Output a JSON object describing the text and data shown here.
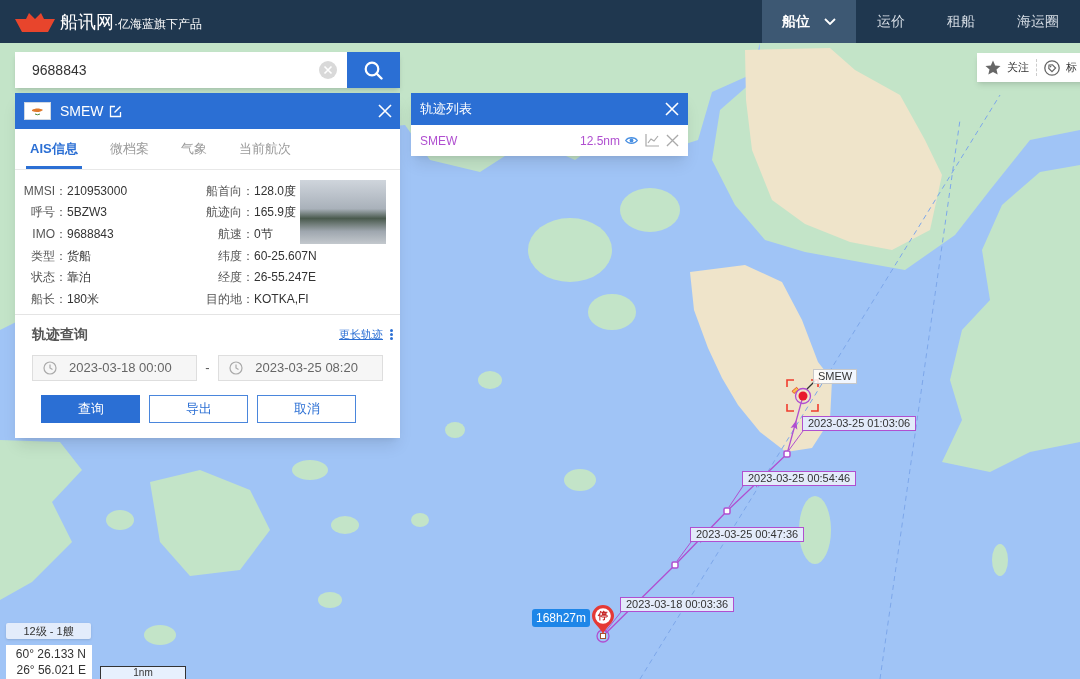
{
  "top_bar": {
    "logo": {
      "name": "船讯网",
      "tagline": "·亿海蓝旗下产品"
    },
    "nav": [
      {
        "label": "船位",
        "selected": true,
        "dropdown": true
      },
      {
        "label": "运价",
        "selected": false,
        "dropdown": false
      },
      {
        "label": "租船",
        "selected": false,
        "dropdown": false
      },
      {
        "label": "海运圈",
        "selected": false,
        "dropdown": false
      }
    ]
  },
  "search": {
    "value": "9688843"
  },
  "ship_panel": {
    "name": "SMEW",
    "tabs": [
      {
        "label": "AIS信息",
        "selected": true
      },
      {
        "label": "微档案",
        "selected": false
      },
      {
        "label": "气象",
        "selected": false
      },
      {
        "label": "当前航次",
        "selected": false
      }
    ],
    "info_left": [
      {
        "label": "MMSI：",
        "value": "210953000"
      },
      {
        "label": "呼号：",
        "value": "5BZW3"
      },
      {
        "label": "IMO：",
        "value": "9688843"
      },
      {
        "label": "类型：",
        "value": "货船"
      },
      {
        "label": "状态：",
        "value": "靠泊"
      },
      {
        "label": "船长：",
        "value": "180米"
      }
    ],
    "info_right": [
      {
        "label": "船首向：",
        "value": "128.0度"
      },
      {
        "label": "航迹向：",
        "value": "165.9度"
      },
      {
        "label": "航速：",
        "value": "0节"
      },
      {
        "label": "纬度：",
        "value": "60-25.607N"
      },
      {
        "label": "经度：",
        "value": "26-55.247E"
      },
      {
        "label": "目的地：",
        "value": "KOTKA,FI"
      }
    ]
  },
  "track_query": {
    "title": "轨迹查询",
    "more_link": "更长轨迹",
    "start_time": "2023-03-18 00:00",
    "separator": "-",
    "end_time": "2023-03-25 08:20",
    "buttons": [
      {
        "label": "查询",
        "kind": "primary"
      },
      {
        "label": "导出",
        "kind": "secondary"
      },
      {
        "label": "取消",
        "kind": "secondary"
      }
    ]
  },
  "track_list": {
    "title": "轨迹列表",
    "items": [
      {
        "name": "SMEW",
        "distance": "12.5nm",
        "color": "#b04fd0"
      }
    ]
  },
  "map_toolbar": [
    {
      "label": "关注",
      "kind": "star"
    },
    {
      "label": "标",
      "kind": "tag"
    }
  ],
  "map": {
    "ship_label": "SMEW",
    "track_labels": [
      "2023-03-25 01:03:06",
      "2023-03-25 00:54:46",
      "2023-03-25 00:47:36",
      "2023-03-18 00:03:36"
    ],
    "stop_duration": "168h27m",
    "stop_marker": "停",
    "zoom_status": "12级 - 1艘",
    "coordinates": [
      "60° 26.133 N",
      "26° 56.021 E"
    ],
    "scale": "1nm"
  }
}
